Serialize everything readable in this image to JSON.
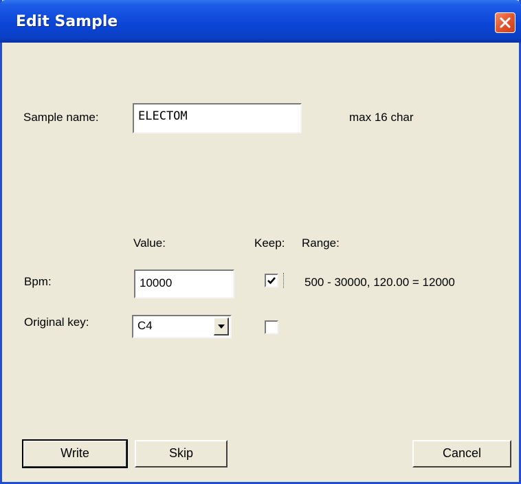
{
  "window": {
    "title": "Edit Sample"
  },
  "sample_name": {
    "label": "Sample name:",
    "value": "ELECTOM",
    "hint": "max 16 char"
  },
  "columns": {
    "value_header": "Value:",
    "keep_header": "Keep:",
    "range_header": "Range:"
  },
  "bpm": {
    "label": "Bpm:",
    "value": "10000",
    "keep_checked": true,
    "range": "500 - 30000, 120.00 = 12000"
  },
  "original_key": {
    "label": "Original key:",
    "value": "C4",
    "keep_checked": false
  },
  "buttons": {
    "write": "Write",
    "skip": "Skip",
    "cancel": "Cancel"
  }
}
